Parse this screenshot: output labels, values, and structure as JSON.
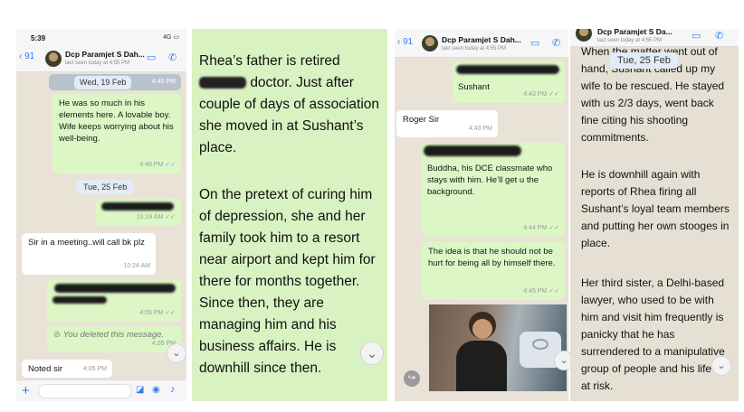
{
  "chat1": {
    "status_time": "5:39",
    "status_network": "4G",
    "back_count": "91",
    "contact_name": "Dcp Paramjet S Dah...",
    "last_seen": "last seen today at 4:55 PM",
    "messages": [
      {
        "date": "Wed, 19 Feb",
        "time": "4:45 PM"
      },
      {
        "text": "He was so much in his elements here. A lovable boy. Wife keeps worrying about his well-being.",
        "time": "4:46 PM"
      },
      {
        "date": "Tue, 25 Feb"
      },
      {
        "time": "10:19 AM"
      },
      {
        "text": "Sir in a meeting..will call bk plz",
        "time": "10:24 AM"
      },
      {
        "time": "4:05 PM"
      },
      {
        "text": "You deleted this message.",
        "time": "4:05 PM"
      },
      {
        "text": "Noted sir",
        "time": "4:05 PM"
      }
    ]
  },
  "chat2": {
    "para1": "Rhea’s father is retired ████ doctor. Just after couple of days of association she moved in at Sushant’s place.",
    "para1_a": "Rhea’s father is retired",
    "para1_b": "doctor. Just after couple of days of association she moved in at Sushant’s place.",
    "para2": "On the pretext of curing him of depression, she and her family took him to a resort near airport and kept him for there for months together. Since then, they are managing him and his business affairs. He is downhill since then."
  },
  "chat3": {
    "back_count": "91",
    "contact_name": "Dcp Paramjet S Dah...",
    "last_seen": "last seen today at 4:55 PM",
    "messages": [
      {
        "text": "Sushant",
        "time": "4:43 PM"
      },
      {
        "text": "Roger Sir",
        "time": "4:43 PM"
      },
      {
        "text": "Buddha, his DCE classmate who stays with him. He’ll get u the background.",
        "time": "4:44 PM"
      },
      {
        "text": "The idea is that he should not be hurt for being all by himself there.",
        "time": "4:45 PM"
      }
    ]
  },
  "chat4": {
    "contact_name": "Dcp Paramjet S Da...",
    "last_seen": "last seen today at 4:55 PM",
    "date": "Tue, 25 Feb",
    "para1": "When the matter went out of hand, Sushant called up my wife to be rescued. He stayed with us 2/3 days, went back fine citing his shooting commitments.",
    "para2": "He is downhill again with reports of Rhea firing all Sushant’s loyal team members and putting her own stooges in place.",
    "para3": "Her third sister, a Delhi-based lawyer, who used to be with him and visit him frequently is panicky that he has surrendered to a manipulative group of people and his life is at risk."
  },
  "colors": {
    "outgoing": "#dcf7c5",
    "incoming": "#ffffff",
    "accent": "#2f7bf6",
    "chat_bg": "#e9e2d6"
  },
  "icons": [
    "video-call-icon",
    "phone-icon",
    "chevron-down-icon",
    "plus-icon",
    "sticker-icon",
    "camera-icon",
    "microphone-icon",
    "ban-icon",
    "double-check-icon"
  ]
}
